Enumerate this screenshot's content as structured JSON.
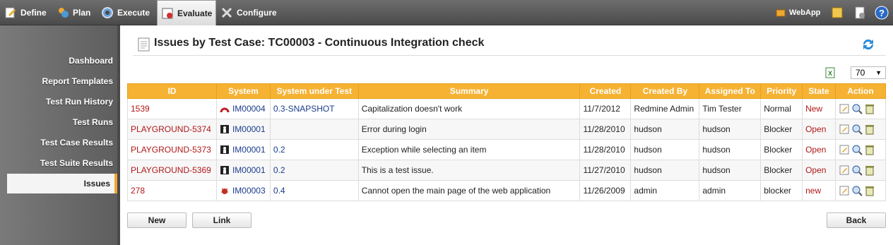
{
  "topnav": {
    "define": "Define",
    "plan": "Plan",
    "execute": "Execute",
    "evaluate": "Evaluate",
    "configure": "Configure",
    "webapp": "WebApp"
  },
  "sidebar": {
    "items": [
      "Dashboard",
      "Report Templates",
      "Test Run History",
      "Test Runs",
      "Test Case Results",
      "Test Suite Results",
      "Issues"
    ]
  },
  "page": {
    "title": "Issues by Test Case: TC00003 - Continuous Integration check"
  },
  "pager": {
    "page_size": "70"
  },
  "table": {
    "headers": [
      "ID",
      "System",
      "System under Test",
      "Summary",
      "Created",
      "Created By",
      "Assigned To",
      "Priority",
      "State",
      "Action"
    ],
    "rows": [
      {
        "id": "1539",
        "system": "IM00004",
        "sut": "0.3-SNAPSHOT",
        "summary": "Capitalization doesn't work",
        "created": "11/7/2012",
        "created_by": "Redmine Admin",
        "assigned_to": "Tim Tester",
        "priority": "Normal",
        "state": "New"
      },
      {
        "id": "PLAYGROUND-5374",
        "system": "IM00001",
        "sut": "",
        "summary": "Error during login",
        "created": "11/28/2010",
        "created_by": "hudson",
        "assigned_to": "hudson",
        "priority": "Blocker",
        "state": "Open"
      },
      {
        "id": "PLAYGROUND-5373",
        "system": "IM00001",
        "sut": "0.2",
        "summary": "Exception while selecting an item",
        "created": "11/28/2010",
        "created_by": "hudson",
        "assigned_to": "hudson",
        "priority": "Blocker",
        "state": "Open"
      },
      {
        "id": "PLAYGROUND-5369",
        "system": "IM00001",
        "sut": "0.2",
        "summary": "This is a test issue.",
        "created": "11/27/2010",
        "created_by": "hudson",
        "assigned_to": "hudson",
        "priority": "Blocker",
        "state": "Open"
      },
      {
        "id": "278",
        "system": "IM00003",
        "sut": "0.4",
        "summary": "Cannot open the main page of the web application",
        "created": "11/26/2009",
        "created_by": "admin",
        "assigned_to": "admin",
        "priority": "blocker",
        "state": "new"
      }
    ]
  },
  "buttons": {
    "new": "New",
    "link": "Link",
    "back": "Back"
  }
}
